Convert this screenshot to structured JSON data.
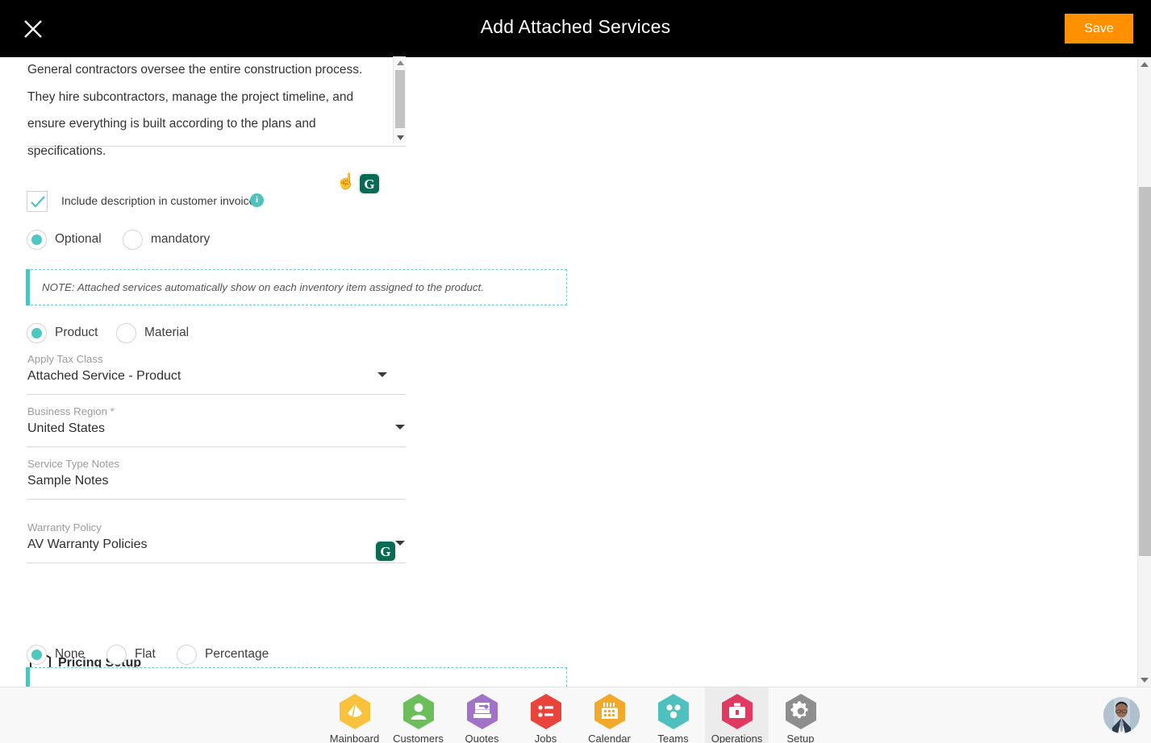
{
  "header": {
    "title": "Add Attached Services",
    "close_icon": "close-icon",
    "save_label": "Save"
  },
  "description": {
    "text": "General contractors oversee the entire construction process. They hire subcontractors, manage the project timeline, and ensure everything is built according to the plans and specifications.",
    "hand_icon": "☝",
    "grammarly_icon": "G"
  },
  "invoice_checkbox": {
    "label": "Include description in customer invoice",
    "checked": true,
    "info_icon": "i"
  },
  "requirement_radios": {
    "options": [
      {
        "label": "Optional",
        "selected": true
      },
      {
        "label": "mandatory",
        "selected": false
      }
    ]
  },
  "note_primary": {
    "text": "NOTE: Attached services automatically show on each inventory item assigned to the product."
  },
  "type_radios": {
    "options": [
      {
        "label": "Product",
        "selected": true
      },
      {
        "label": "Material",
        "selected": false
      }
    ]
  },
  "fields": [
    {
      "label": "Apply Tax Class",
      "value": "Attached Service - Product",
      "has_caret": true
    },
    {
      "label": "Business Region *",
      "value": "United States",
      "has_caret": true
    },
    {
      "label": "Service Type Notes",
      "value": "Sample Notes",
      "has_caret": false
    },
    {
      "label": "Warranty Policy",
      "value": "AV Warranty Policies",
      "has_caret": true
    }
  ],
  "pricing_setup": {
    "title": "Pricing Setup",
    "hex_icon": "hexagon-icon",
    "options": [
      {
        "label": "None",
        "selected": true
      },
      {
        "label": "Flat",
        "selected": false
      },
      {
        "label": "Percentage",
        "selected": false
      }
    ]
  },
  "bottom_nav": {
    "items": [
      {
        "label": "Mainboard",
        "icon": "dashboard-icon",
        "color": "#F9C23C",
        "active": false
      },
      {
        "label": "Customers",
        "icon": "person-icon",
        "color": "#6CBE5B",
        "active": false
      },
      {
        "label": "Quotes",
        "icon": "cards-icon",
        "color": "#A172C8",
        "active": false
      },
      {
        "label": "Jobs",
        "icon": "list-icon",
        "color": "#E8443C",
        "active": false
      },
      {
        "label": "Calendar",
        "icon": "calendar-icon",
        "color": "#F2A828",
        "active": false
      },
      {
        "label": "Teams",
        "icon": "group-icon",
        "color": "#4EC0BE",
        "active": false
      },
      {
        "label": "Operations",
        "icon": "briefcase-icon",
        "color": "#E03A63",
        "active": true
      },
      {
        "label": "Setup",
        "icon": "gear-icon",
        "color": "#8E8E8E",
        "active": false
      }
    ],
    "avatar": "user-avatar"
  },
  "colors": {
    "accent_teal": "#4dc3bd",
    "save_orange": "#FF9000",
    "header_black": "#000000"
  }
}
